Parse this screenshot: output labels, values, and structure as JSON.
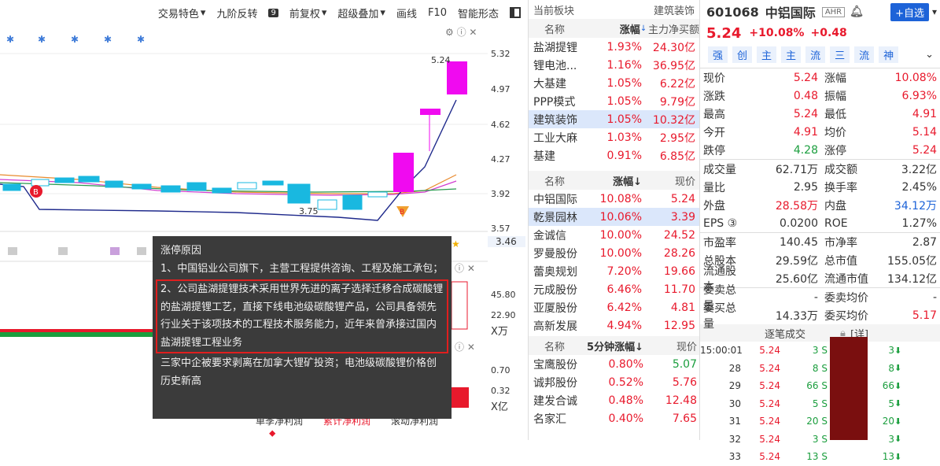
{
  "toolbar": {
    "items": [
      "交易特色",
      "九阶反转",
      "前复权",
      "超级叠加",
      "画线",
      "F10",
      "智能形态"
    ],
    "badge": "9"
  },
  "yaxis": [
    "5.32",
    "4.97",
    "4.62",
    "4.27",
    "3.92",
    "3.57",
    "3.46",
    "45.80",
    "22.90",
    "X万",
    "0.70",
    "0.32",
    "X亿"
  ],
  "chart_labels": {
    "high": "5.24",
    "low": "3.75"
  },
  "bottom_tabs": [
    "单季净利润",
    "累计净利润",
    "滚动净利润"
  ],
  "popup": {
    "title": "涨停原因",
    "line1": "1、中国铝业公司旗下，主营工程提供咨询、工程及施工承包；",
    "line2": "2、公司盐湖提锂技术采用世界先进的离子选择迁移合成碳酸锂的盐湖提锂工艺，直接下线电池级碳酸锂产品，公司具备领先行业关于该项技术的工程技术服务能力，近年来曾承接过国内盐湖提锂工程业务",
    "line3": "三家中企被要求剥离在加拿大锂矿投资；电池级碳酸锂价格创历史新高"
  },
  "mid": {
    "title": "当前板块",
    "tag": "建筑装饰",
    "h1": [
      "名称",
      "涨幅",
      "主力净买额"
    ],
    "sectors": [
      [
        "盐湖提锂",
        "1.93%",
        "24.30亿"
      ],
      [
        "锂电池...",
        "1.16%",
        "36.95亿"
      ],
      [
        "大基建",
        "1.05%",
        "6.22亿"
      ],
      [
        "PPP模式",
        "1.05%",
        "9.79亿"
      ],
      [
        "建筑装饰",
        "1.05%",
        "10.32亿"
      ],
      [
        "工业大麻",
        "1.03%",
        "2.95亿"
      ],
      [
        "基建",
        "0.91%",
        "6.85亿"
      ]
    ],
    "h2": [
      "名称",
      "涨幅↓",
      "现价"
    ],
    "stocks": [
      [
        "中铝国际",
        "10.08%",
        "5.24"
      ],
      [
        "乾景园林",
        "10.06%",
        "3.39"
      ],
      [
        "金诚信",
        "10.00%",
        "24.52"
      ],
      [
        "罗曼股份",
        "10.00%",
        "28.26"
      ],
      [
        "蕾奥规划",
        "7.20%",
        "19.66"
      ],
      [
        "元成股份",
        "6.46%",
        "11.70"
      ],
      [
        "亚厦股份",
        "6.42%",
        "4.81"
      ],
      [
        "高新发展",
        "4.94%",
        "12.95"
      ]
    ],
    "h3": [
      "名称",
      "5分钟涨幅↓",
      "现价"
    ],
    "fast": [
      [
        "宝鹰股份",
        "0.80%",
        "5.07"
      ],
      [
        "诚邦股份",
        "0.52%",
        "5.76"
      ],
      [
        "建发合诚",
        "0.48%",
        "12.48"
      ],
      [
        "名家汇",
        "0.40%",
        "7.65"
      ]
    ]
  },
  "right": {
    "code": "601068",
    "name": "中铝国际",
    "badge": "AHR",
    "add": "+自选",
    "price": "5.24",
    "pct": "+10.08%",
    "chg": "+0.48",
    "tags": [
      "强",
      "创",
      "主",
      "主",
      "流",
      "三",
      "流",
      "神"
    ],
    "quotes": [
      [
        "现价",
        "5.24",
        "涨幅",
        "10.08%"
      ],
      [
        "涨跌",
        "0.48",
        "振幅",
        "6.93%"
      ],
      [
        "最高",
        "5.24",
        "最低",
        "4.91"
      ],
      [
        "今开",
        "4.91",
        "均价",
        "5.14"
      ],
      [
        "跌停",
        "4.28",
        "涨停",
        "5.24"
      ]
    ],
    "quotes2": [
      [
        "成交量",
        "62.71万",
        "成交额",
        "3.22亿"
      ],
      [
        "量比",
        "2.95",
        "换手率",
        "2.45%"
      ],
      [
        "外盘",
        "28.58万",
        "内盘",
        "34.12万"
      ],
      [
        "EPS ③",
        "0.0200",
        "ROE",
        "1.27%"
      ]
    ],
    "quotes3": [
      [
        "市盈率",
        "140.45",
        "市净率",
        "2.87"
      ],
      [
        "总股本",
        "29.59亿",
        "总市值",
        "155.05亿"
      ],
      [
        "流通股本",
        "25.60亿",
        "流通市值",
        "134.12亿"
      ]
    ],
    "quotes4": [
      [
        "委卖总量",
        "-",
        "委卖均价",
        "-"
      ],
      [
        "委买总量",
        "14.33万",
        "委买均价",
        "5.17"
      ]
    ],
    "ticks_title": "逐笔成交",
    "ticks_detail": "[详]",
    "ticks": [
      [
        "15:00:01",
        "5.24",
        "3 S",
        "3"
      ],
      [
        "28",
        "5.24",
        "8 S",
        "8"
      ],
      [
        "29",
        "5.24",
        "66 S",
        "66"
      ],
      [
        "30",
        "5.24",
        "5 S",
        "5"
      ],
      [
        "31",
        "5.24",
        "20 S",
        "20"
      ],
      [
        "32",
        "5.24",
        "3 S",
        "3"
      ],
      [
        "33",
        "5.24",
        "13 S",
        "13"
      ]
    ]
  }
}
